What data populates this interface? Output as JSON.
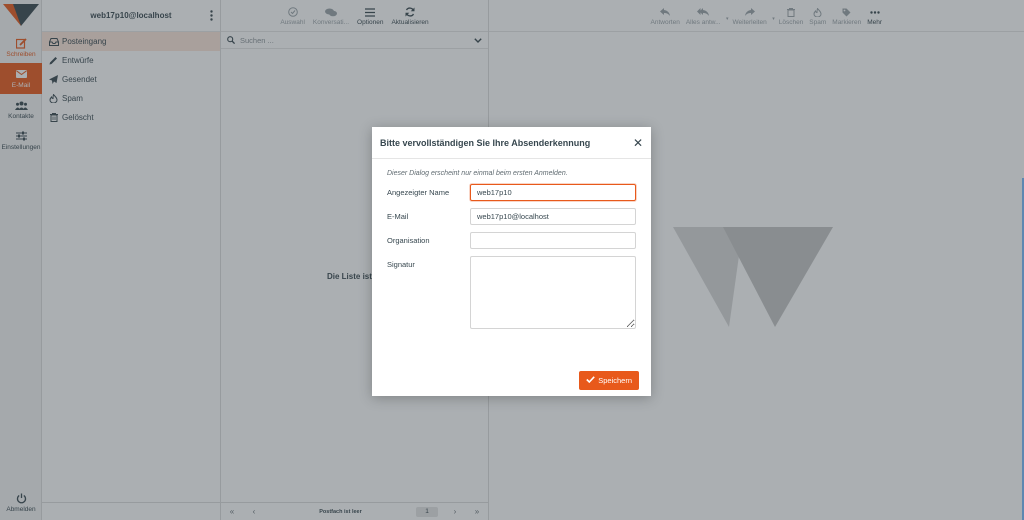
{
  "account": "web17p10@localhost",
  "rail": {
    "compose": "Schreiben",
    "mail": "E-Mail",
    "contacts": "Kontakte",
    "settings": "Einstellungen",
    "logout": "Abmelden"
  },
  "folders": [
    {
      "label": "Posteingang",
      "icon": "inbox-icon"
    },
    {
      "label": "Entwürfe",
      "icon": "pencil-icon"
    },
    {
      "label": "Gesendet",
      "icon": "paper-plane-icon"
    },
    {
      "label": "Spam",
      "icon": "fire-icon"
    },
    {
      "label": "Gelöscht",
      "icon": "trash-icon"
    }
  ],
  "list_toolbar": {
    "select": "Auswahl",
    "threads": "Konversati...",
    "options": "Optionen",
    "refresh": "Aktualisieren"
  },
  "search": {
    "placeholder": "Suchen ..."
  },
  "list": {
    "empty": "Die Liste ist leer.",
    "status": "Postfach ist leer",
    "page": "1"
  },
  "content_toolbar": {
    "reply": "Antworten",
    "reply_all": "Alles antw...",
    "forward": "Weiterleiten",
    "delete": "Löschen",
    "spam": "Spam",
    "mark": "Markieren",
    "more": "Mehr"
  },
  "dialog": {
    "title": "Bitte vervollständigen Sie Ihre Absenderkennung",
    "hint": "Dieser Dialog erscheint nur einmal beim ersten Anmelden.",
    "name_label": "Angezeigter Name",
    "name_value": "web17p10",
    "email_label": "E-Mail",
    "email_value": "web17p10@localhost",
    "org_label": "Organisation",
    "org_value": "",
    "sig_label": "Signatur",
    "sig_value": "",
    "save": "Speichern"
  },
  "colors": {
    "accent": "#e8591b",
    "text": "#37474f",
    "overlay": "rgba(55,65,72,0.42)"
  }
}
